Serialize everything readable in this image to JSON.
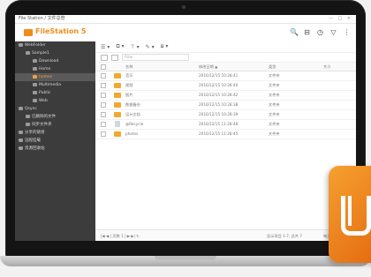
{
  "colors": {
    "accent": "#f08c1e",
    "sidebar_bg": "#3c3c3c",
    "folder": "#f2a830"
  },
  "window": {
    "title": "File Station / 文件总管",
    "controls": "— □ ×"
  },
  "app": {
    "name": "FileStation 5"
  },
  "top_icons": [
    "search-icon",
    "storage-icon",
    "clock-icon",
    "filter-icon",
    "more-icon"
  ],
  "top_icon_glyphs": [
    "🔍",
    "⊟",
    "◷",
    "▽",
    "⋮"
  ],
  "toolbar": {
    "items": [
      "☰ ▾",
      "⧉ ▾",
      "⊤ ▾",
      "✎ ▾",
      "⧇ ▾"
    ]
  },
  "filter": {
    "placeholder": "Filter"
  },
  "sidebar": {
    "items": [
      {
        "label": "WebFolder",
        "level": 0
      },
      {
        "label": "Sample1",
        "level": 1
      },
      {
        "label": "Download",
        "level": 2
      },
      {
        "label": "Home",
        "level": 2
      },
      {
        "label": "homes",
        "level": 2,
        "selected": true
      },
      {
        "label": "Multimedia",
        "level": 2
      },
      {
        "label": "Public",
        "level": 2
      },
      {
        "label": "Web",
        "level": 2
      },
      {
        "label": "Qsync",
        "level": 0
      },
      {
        "label": "已删除的文件",
        "level": 1
      },
      {
        "label": "同步文件夹",
        "level": 1
      },
      {
        "label": "分享的链接",
        "level": 0
      },
      {
        "label": "远程挂载",
        "level": 0
      },
      {
        "label": "资源回收站",
        "level": 0
      }
    ]
  },
  "table": {
    "headers": [
      "名称",
      "修改日期 ▲",
      "类型",
      "大小"
    ],
    "rows": [
      {
        "name": "音乐",
        "date": "2016/12/15 10:28:41",
        "type": "文件夹",
        "kind": "folder"
      },
      {
        "name": "视频",
        "date": "2016/12/15 10:28:40",
        "type": "文件夹",
        "kind": "folder"
      },
      {
        "name": "图片",
        "date": "2016/12/15 10:28:42",
        "type": "文件夹",
        "kind": "folder"
      },
      {
        "name": "数据备份",
        "date": "2016/12/15 10:28:38",
        "type": "文件夹",
        "kind": "folder"
      },
      {
        "name": "设计文档",
        "date": "2016/12/15 10:28:39",
        "type": "文件夹",
        "kind": "folder"
      },
      {
        "name": "@Recycle",
        "date": "2016/12/15 11:28:48",
        "type": "文件夹",
        "kind": "file"
      },
      {
        "name": "photos",
        "date": "2016/12/15 11:28:45",
        "type": "文件夹",
        "kind": "folder"
      }
    ]
  },
  "footer": {
    "pager": "|◀  ◀  |  页数  1  |  ▶  ▶|  ↻",
    "count_label": "显示项目 1-7, 总共 7",
    "per_page": "每页 50 ▾"
  }
}
